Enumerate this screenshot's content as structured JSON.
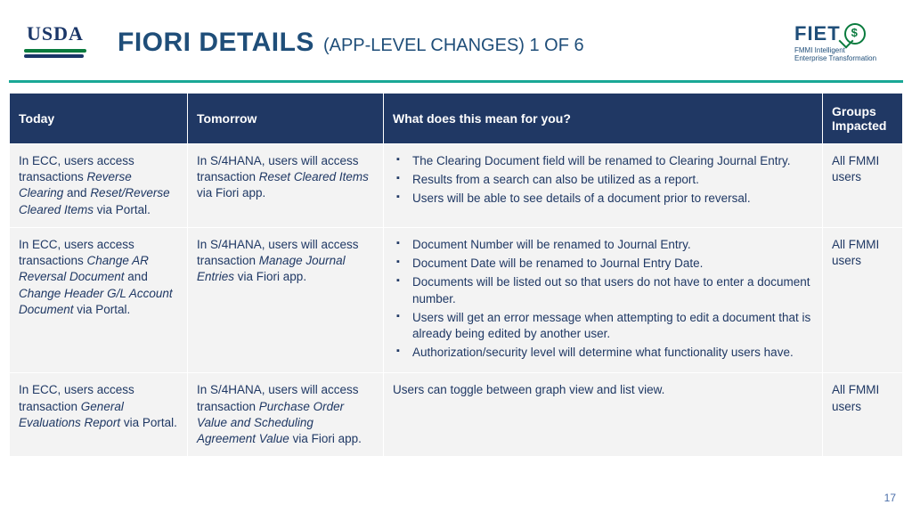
{
  "logos": {
    "usda_text": "USDA",
    "fiet_text": "FIET",
    "fiet_sub1": "FMMI Intelligent",
    "fiet_sub2": "Enterprise Transformation"
  },
  "title": {
    "main": "FIORI DETAILS",
    "sub": "(APP-LEVEL CHANGES) 1 OF 6"
  },
  "table": {
    "headers": {
      "today": "Today",
      "tomorrow": "Tomorrow",
      "meaning": "What does this mean for you?",
      "groups": "Groups Impacted"
    },
    "rows": [
      {
        "today_pre": "In ECC, users access transactions ",
        "today_it1": "Reverse Clearing",
        "today_mid": " and ",
        "today_it2": "Reset/Reverse Cleared Items",
        "today_post": " via Portal.",
        "tom_pre": "In S/4HANA, users will access transaction ",
        "tom_it": "Reset Cleared Items",
        "tom_post": " via Fiori app.",
        "mean_bullets": [
          "The Clearing Document field will be renamed to Clearing Journal Entry.",
          "Results from a search can also be utilized as a report.",
          "Users will be able to see details of a document prior to reversal."
        ],
        "groups": "All FMMI users"
      },
      {
        "today_pre": "In ECC, users access transactions ",
        "today_it1": "Change AR Reversal Document",
        "today_mid": " and ",
        "today_it2": "Change Header G/L Account Document",
        "today_post": " via Portal.",
        "tom_pre": "In S/4HANA, users will access transaction ",
        "tom_it": "Manage Journal Entries",
        "tom_post": " via Fiori app.",
        "mean_bullets": [
          "Document Number will be renamed to Journal Entry.",
          "Document Date will be renamed to Journal Entry Date.",
          "Documents will be listed out so that users do not have to enter a document number.",
          "Users will get an error message when attempting to edit a document that is already being edited by another user.",
          "Authorization/security level will determine what functionality users have."
        ],
        "groups": "All FMMI users"
      },
      {
        "today_pre": "In ECC, users access transaction ",
        "today_it1": "General Evaluations Report",
        "today_mid": "",
        "today_it2": "",
        "today_post": " via Portal.",
        "tom_pre": "In S/4HANA, users will access transaction ",
        "tom_it": "Purchase Order Value and Scheduling Agreement Value",
        "tom_post": " via Fiori app.",
        "mean_plain": "Users can toggle between graph view and list view.",
        "groups": "All FMMI users"
      }
    ]
  },
  "page_number": "17"
}
